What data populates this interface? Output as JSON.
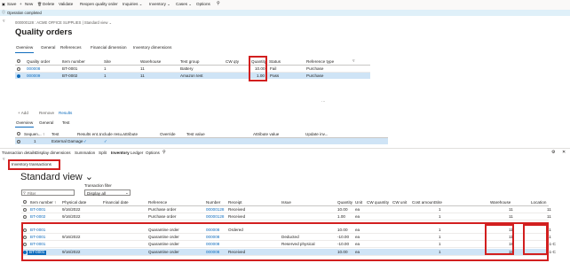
{
  "toolbar": {
    "items": [
      {
        "icon": "save-icon",
        "label": "Save"
      },
      {
        "icon": "new-icon",
        "label": "New"
      },
      {
        "icon": "delete-icon",
        "label": "Delete"
      },
      {
        "icon": "",
        "label": "Validate"
      },
      {
        "icon": "",
        "label": "Reopen quality order"
      },
      {
        "icon": "",
        "label": "Inquiries ⌄"
      },
      {
        "icon": "",
        "label": "Inventory ⌄"
      },
      {
        "icon": "",
        "label": "Cases ⌄"
      },
      {
        "icon": "",
        "label": "Options"
      }
    ]
  },
  "message": "Operation completed",
  "breadcrumb": "000000128 : ACME OFFICE SUPPLIES  |  Standard view ⌄",
  "page_title": "Quality orders",
  "main_tabs": [
    "Overview",
    "General",
    "References",
    "Financial dimension",
    "Inventory dimensions"
  ],
  "orders": {
    "headers": [
      "Quality order",
      "Item number",
      "Site",
      "Warehouse",
      "Test group",
      "CW qty",
      "Quantity",
      "Status",
      "Reference type"
    ],
    "rows": [
      [
        "000008",
        "BT-0001",
        "1",
        "11",
        "Battery",
        "",
        "10.00",
        "Fail",
        "Purchase"
      ],
      [
        "000009",
        "BT-0002",
        "1",
        "11",
        "Amazon test",
        "",
        "1.00",
        "Pass",
        "Purchase"
      ]
    ]
  },
  "lines_toolbar": {
    "add": "+ Add",
    "remove": "Remove",
    "results": "Results"
  },
  "lines_tabs": [
    "Overview",
    "General",
    "Test"
  ],
  "lines": {
    "headers": [
      "Sequen... ↑",
      "Test",
      "Results ent...",
      "Include resu...",
      "Attribute",
      "Override",
      "Test value",
      "Attribute value",
      "Update inv..."
    ],
    "row": [
      "1",
      "External Damage",
      "✓",
      "✓",
      "",
      "",
      "",
      "",
      ""
    ]
  },
  "trans_menu": [
    "Transaction details",
    "Display dimensions",
    "Summation",
    "Split",
    "Inventory",
    "Ledger",
    "Options"
  ],
  "inv_tab": "Inventory transactions",
  "view_title": "Standard view ⌄",
  "filter": {
    "placeholder": "Filter",
    "label": "Transaction filter",
    "value": "Display all"
  },
  "trans": {
    "headers": [
      "Item number ↑",
      "Physical date",
      "Financial date",
      "Reference",
      "Number",
      "Receipt",
      "Issue",
      "Quantity",
      "Unit",
      "CW quantity",
      "CW unit",
      "Cost amount",
      "Site",
      "Warehouse",
      "Location"
    ],
    "rows": [
      [
        "BT-0001",
        "9/16/2022",
        "",
        "Purchase order",
        "00000128",
        "Received",
        "",
        "10.00",
        "ea",
        "",
        "",
        "",
        "1",
        "11",
        "11"
      ],
      [
        "BT-0002",
        "9/16/2022",
        "",
        "Purchase order",
        "00000128",
        "Received",
        "",
        "1.00",
        "ea",
        "",
        "",
        "",
        "1",
        "11",
        "11"
      ],
      [
        "BT-0001",
        "",
        "",
        "Quarantine order",
        "000008",
        "Ordered",
        "",
        "10.00",
        "ea",
        "",
        "",
        "",
        "1",
        "11",
        "11"
      ],
      [
        "BT-0001",
        "9/16/2022",
        "",
        "Quarantine order",
        "000008",
        "",
        "Deducted",
        "-10.00",
        "ea",
        "",
        "",
        "",
        "1",
        "11",
        "11"
      ],
      [
        "BT-0001",
        "",
        "",
        "Quarantine order",
        "000008",
        "",
        "Reserved physical",
        "-10.00",
        "ea",
        "",
        "",
        "",
        "1",
        "18",
        "41-C"
      ],
      [
        "BT-0001",
        "9/16/2022",
        "",
        "Quarantine order",
        "000008",
        "Received",
        "",
        "10.00",
        "ea",
        "",
        "",
        "",
        "1",
        "18",
        "41-C"
      ]
    ]
  }
}
